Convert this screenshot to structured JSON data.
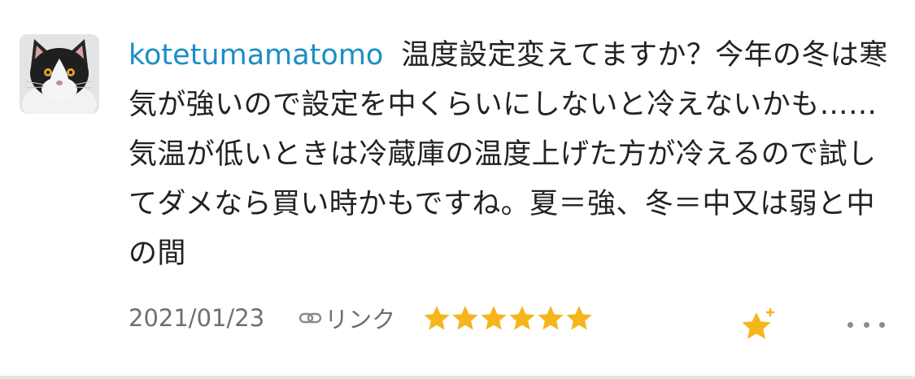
{
  "comment": {
    "username": "kotetumamatomo",
    "text": "温度設定変えてますか？今年の冬は寒気が強いので設定を中くらいにしないと冷えないかも……気温が低いときは冷蔵庫の温度上げた方が冷えるので試してダメなら買い時かもですね。夏＝強、冬＝中又は弱と中の間",
    "date": "2021/01/23",
    "link_label": "リンク",
    "star_count": 6,
    "avatar_icon": "cat-avatar-icon",
    "link_icon": "chain-link-icon",
    "add_star_icon": "add-star-icon",
    "more_icon": "more-options-icon"
  },
  "colors": {
    "username": "#1a8fc6",
    "text": "#222222",
    "meta": "#6f6f6f",
    "star": "#f7b51c"
  }
}
